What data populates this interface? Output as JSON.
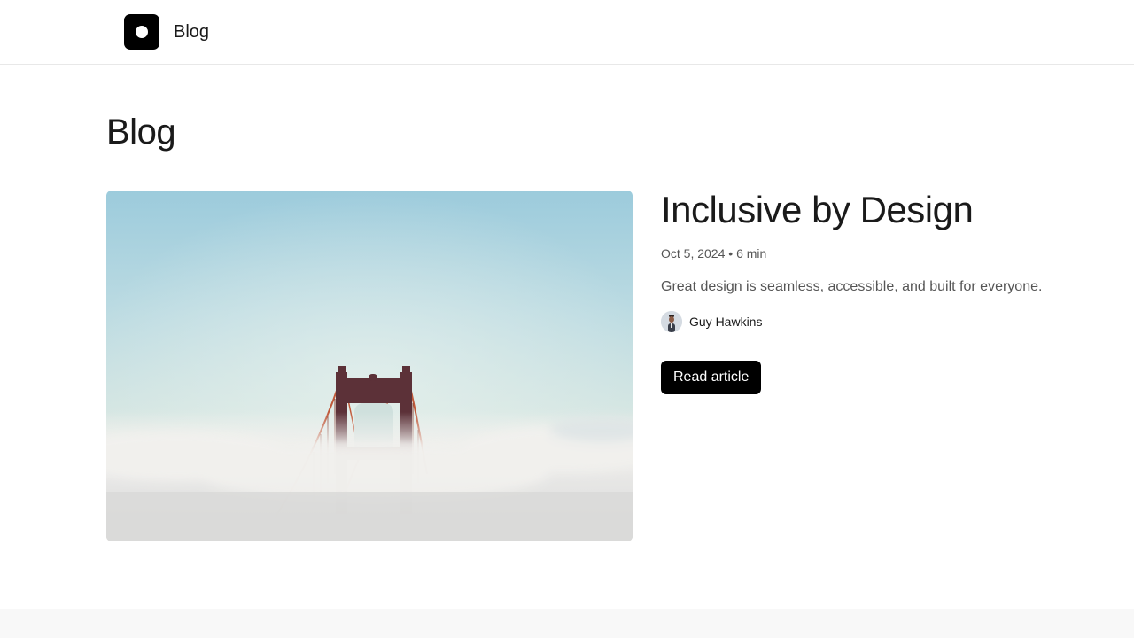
{
  "header": {
    "brand_label": "Blog",
    "logo_icon": "circle-logo-icon"
  },
  "main": {
    "page_title": "Blog",
    "featured_post": {
      "title": "Inclusive by Design",
      "date": "Oct 5, 2024",
      "separator": "•",
      "read_time": "6 min",
      "excerpt": "Great design is seamless, accessible, and built for everyone.",
      "author_name": "Guy Hawkins",
      "cta_label": "Read article",
      "image_alt": "Golden Gate Bridge tower rising above fog"
    }
  },
  "colors": {
    "accent": "#000000",
    "text": "#1a1a1a",
    "muted": "#555555",
    "footer_bg": "#f8f8f8"
  }
}
